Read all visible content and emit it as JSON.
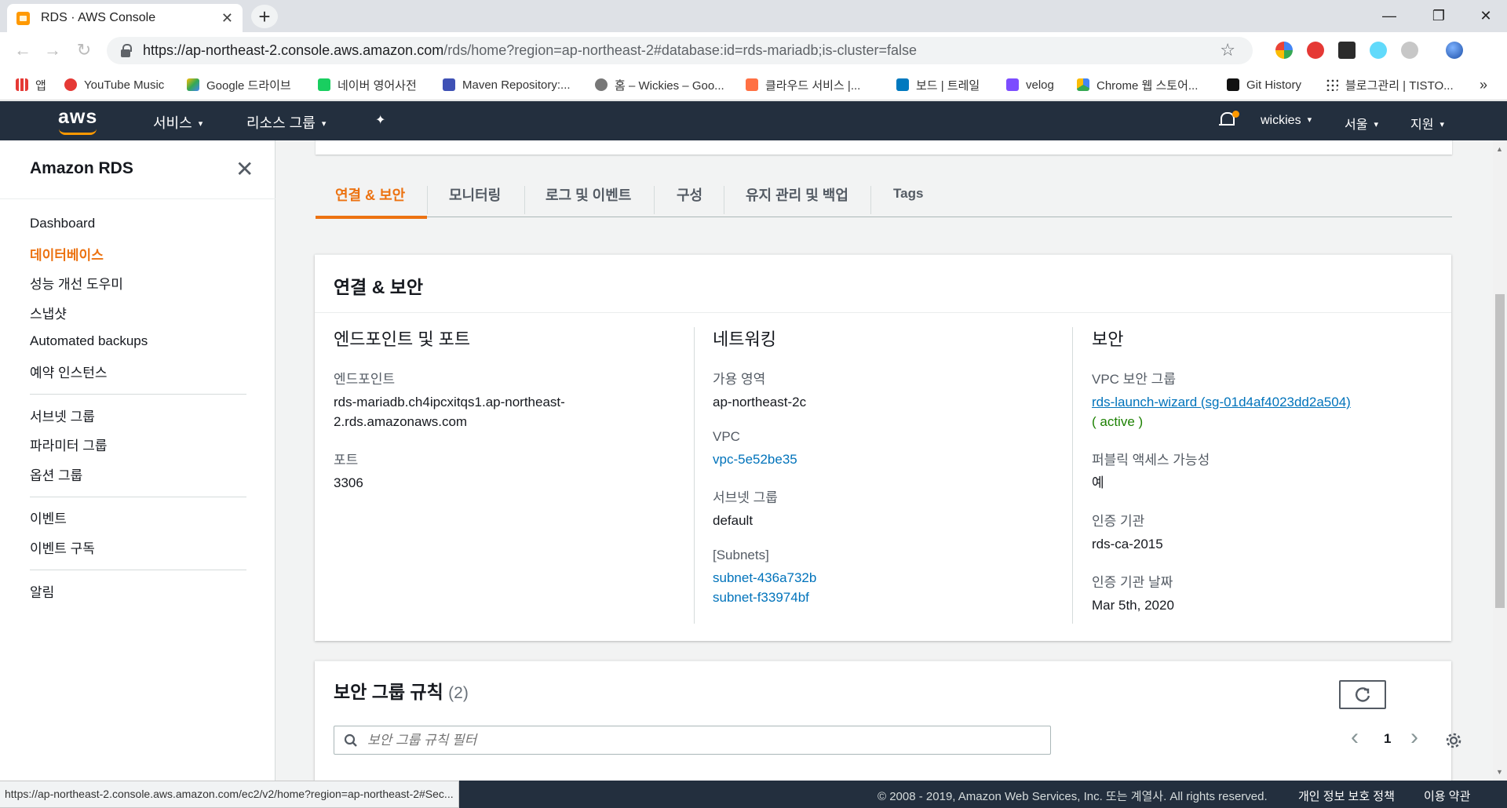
{
  "browser": {
    "tab_title": "RDS · AWS Console",
    "tab_close": "✕",
    "new_tab": "+",
    "url_host": "https://ap-northeast-2.console.aws.amazon.com",
    "url_path": "/rds/home?region=ap-northeast-2#database:id=rds-mariadb;is-cluster=false",
    "min": "—",
    "max": "❐",
    "close": "✕",
    "back": "←",
    "forward": "→",
    "reload": "↻",
    "star": "☆"
  },
  "bookmarks": [
    {
      "label": "앱",
      "color": "#e53935"
    },
    {
      "label": "YouTube Music",
      "color": "#e53935"
    },
    {
      "label": "Google 드라이브",
      "color": "#34a853"
    },
    {
      "label": "네이버 영어사전",
      "color": "#19ce60"
    },
    {
      "label": "Maven Repository:...",
      "color": "#3f51b5"
    },
    {
      "label": "홈 – Wickies – Goo...",
      "color": "#777777"
    },
    {
      "label": "클라우드 서비스 |...",
      "color": "#ff7043"
    },
    {
      "label": "보드 | 트레일",
      "color": "#0079bf"
    },
    {
      "label": "velog",
      "color": "#7c4dff"
    },
    {
      "label": "Chrome 웹 스토어...",
      "color": "#fbbc05"
    },
    {
      "label": "Git History",
      "color": "#111111"
    },
    {
      "label": "블로그관리 | TISTO...",
      "color": "#333333"
    }
  ],
  "awsnav": {
    "logo": "aws",
    "services": "서비스",
    "resource_groups": "리소스 그룹",
    "pin": "✦",
    "user": "wickies",
    "region": "서울",
    "support": "지원",
    "caret": "▾"
  },
  "sidebar": {
    "title": "Amazon RDS",
    "close": "✕",
    "group1": [
      "Dashboard",
      "데이터베이스",
      "성능 개선 도우미",
      "스냅샷",
      "Automated backups",
      "예약 인스턴스"
    ],
    "group2": [
      "서브넷 그룹",
      "파라미터 그룹",
      "옵션 그룹"
    ],
    "group3": [
      "이벤트",
      "이벤트 구독"
    ],
    "group4": [
      "알림"
    ]
  },
  "tabs": [
    "연결 & 보안",
    "모니터링",
    "로그 및 이벤트",
    "구성",
    "유지 관리 및 백업",
    "Tags"
  ],
  "connectivity": {
    "title": "연결 & 보안",
    "endpoint_col": {
      "heading": "엔드포인트 및 포트",
      "endpoint_label": "엔드포인트",
      "endpoint_value_1": "rds-mariadb.ch4ipcxitqs1.ap-northeast-",
      "endpoint_value_2": "2.rds.amazonaws.com",
      "port_label": "포트",
      "port_value": "3306"
    },
    "network_col": {
      "heading": "네트워킹",
      "az_label": "가용 영역",
      "az_value": "ap-northeast-2c",
      "vpc_label": "VPC",
      "vpc_value": "vpc-5e52be35",
      "subnet_group_label": "서브넷 그룹",
      "subnet_group_value": "default",
      "subnets_label": "[Subnets]",
      "subnet_1": "subnet-436a732b",
      "subnet_2": "subnet-f33974bf"
    },
    "security_col": {
      "heading": "보안",
      "sg_label": "VPC 보안 그룹",
      "sg_value": "rds-launch-wizard (sg-01d4af4023dd2a504)",
      "sg_status": "( active )",
      "public_label": "퍼블릭 액세스 가능성",
      "public_value": "예",
      "ca_label": "인증 기관",
      "ca_value": "rds-ca-2015",
      "ca_date_label": "인증 기관 날짜",
      "ca_date_value": "Mar 5th, 2020"
    }
  },
  "sg_rules": {
    "title": "보안 그룹 규칙",
    "count": "(2)",
    "filter_placeholder": "보안 그룹 규칙 필터",
    "page": "1",
    "prev": "‹",
    "next": "›"
  },
  "footer": {
    "status_url": "https://ap-northeast-2.console.aws.amazon.com/ec2/v2/home?region=ap-northeast-2#Sec...",
    "copyright": "© 2008 - 2019, Amazon Web Services, Inc. 또는 계열사. All rights reserved.",
    "privacy": "개인 정보 보호 정책",
    "terms": "이용 약관"
  }
}
